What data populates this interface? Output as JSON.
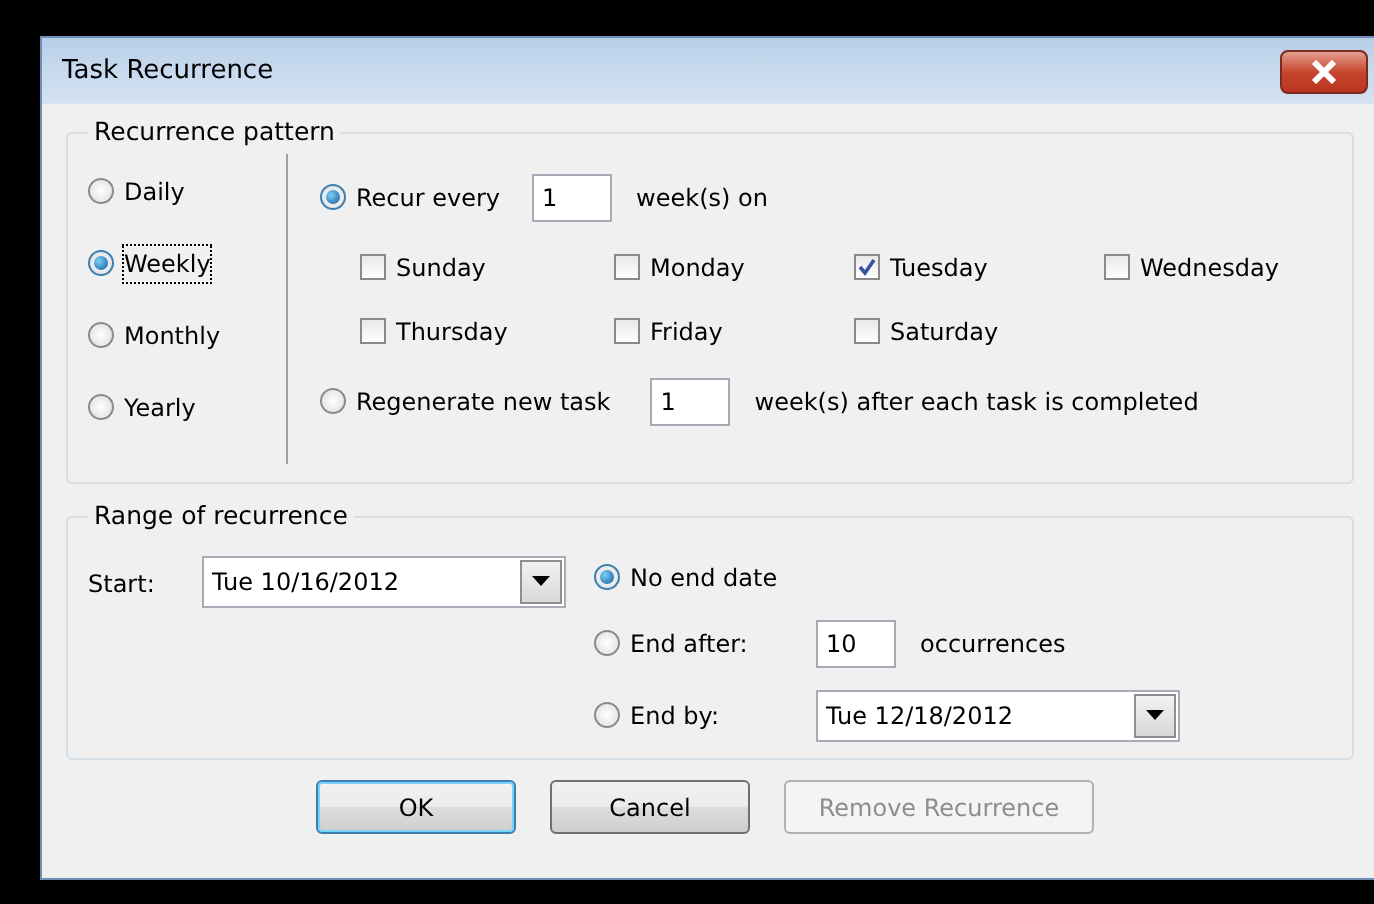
{
  "window": {
    "title": "Task Recurrence"
  },
  "recurrence_pattern": {
    "title": "Recurrence pattern",
    "frequencies": [
      {
        "label": "Daily",
        "selected": false,
        "focused": false
      },
      {
        "label": "Weekly",
        "selected": true,
        "focused": true
      },
      {
        "label": "Monthly",
        "selected": false,
        "focused": false
      },
      {
        "label": "Yearly",
        "selected": false,
        "focused": false
      }
    ],
    "recur": {
      "label": "Recur every",
      "value": "1",
      "suffix": "week(s) on",
      "selected": true
    },
    "days": [
      {
        "label": "Sunday",
        "checked": false
      },
      {
        "label": "Monday",
        "checked": false
      },
      {
        "label": "Tuesday",
        "checked": true
      },
      {
        "label": "Wednesday",
        "checked": false
      },
      {
        "label": "Thursday",
        "checked": false
      },
      {
        "label": "Friday",
        "checked": false
      },
      {
        "label": "Saturday",
        "checked": false
      }
    ],
    "regenerate": {
      "label": "Regenerate new task",
      "value": "1",
      "suffix": "week(s) after each task is completed",
      "selected": false
    }
  },
  "range": {
    "title": "Range of recurrence",
    "start_label": "Start:",
    "start_value": "Tue 10/16/2012",
    "end_options": [
      {
        "kind": "none",
        "label": "No end date",
        "selected": true
      },
      {
        "kind": "after",
        "label": "End after:",
        "value": "10",
        "suffix": "occurrences",
        "selected": false
      },
      {
        "kind": "by",
        "label": "End by:",
        "value": "Tue 12/18/2012",
        "selected": false
      }
    ]
  },
  "buttons": [
    {
      "label": "OK",
      "default": true,
      "disabled": false
    },
    {
      "label": "Cancel",
      "default": false,
      "disabled": false
    },
    {
      "label": "Remove Recurrence",
      "default": false,
      "disabled": true
    }
  ]
}
